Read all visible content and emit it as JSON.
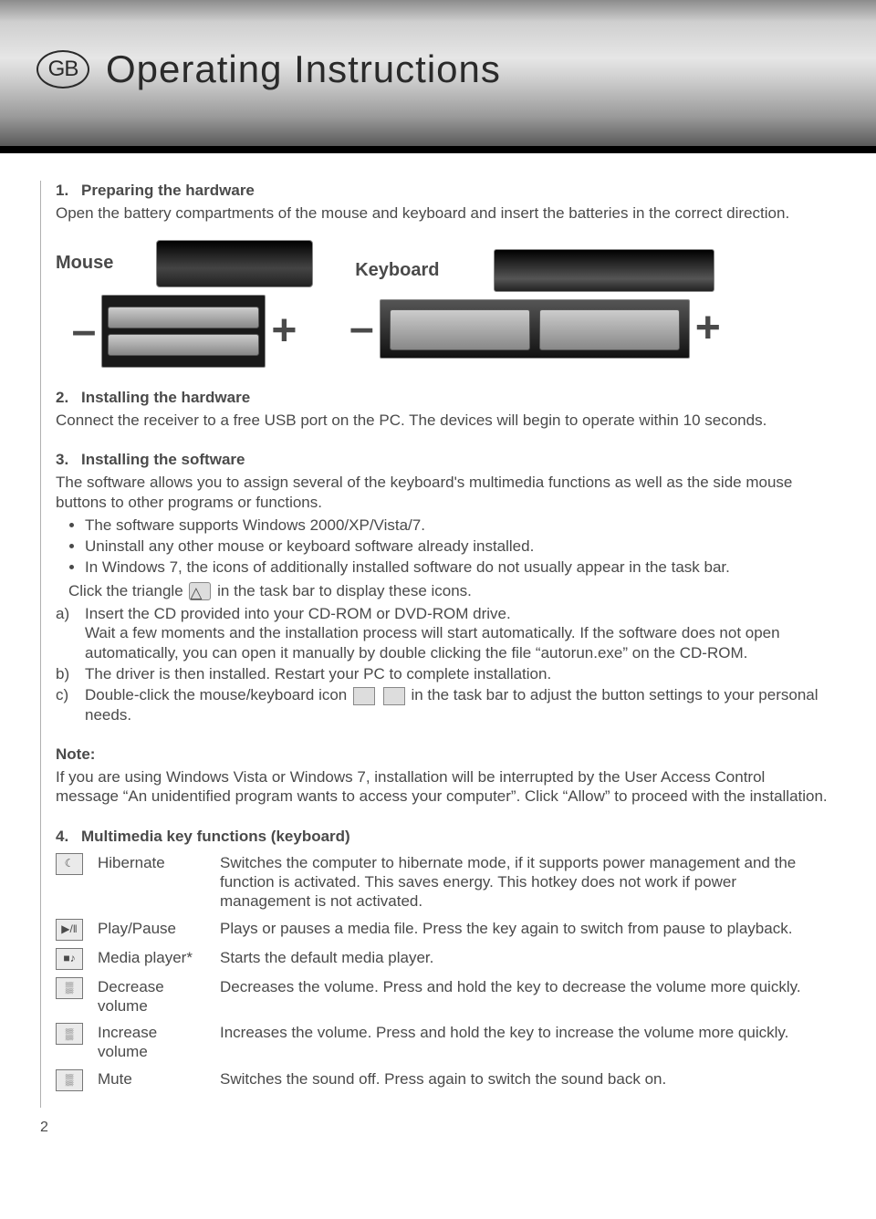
{
  "header": {
    "badge": "GB",
    "title": "Operating Instructions"
  },
  "sections": {
    "s1": {
      "num": "1.",
      "heading": "Preparing the hardware",
      "body": "Open the battery compartments of the mouse and keyboard and insert the batteries in the correct direction."
    },
    "hw": {
      "mouse_label": "Mouse",
      "keyboard_label": "Keyboard",
      "minus": "–",
      "plus": "+"
    },
    "s2": {
      "num": "2.",
      "heading": "Installing the hardware",
      "body": "Connect the receiver to a free USB port on the PC. The devices will begin to operate within 10 seconds."
    },
    "s3": {
      "num": "3.",
      "heading": "Installing the software",
      "body": "The software allows you to assign several of the keyboard's multimedia functions as well as the side mouse buttons to other programs or functions.",
      "bullets": [
        "The software supports Windows 2000/XP/Vista/7.",
        "Uninstall any other mouse or keyboard software already installed.",
        "In Windows 7, the icons of additionally installed software do not usually appear in the task bar."
      ],
      "click_line_a": "Click the triangle",
      "click_line_b": "in the task bar to display these icons.",
      "steps": {
        "a": {
          "lt": "a)",
          "text1": "Insert the CD provided into your CD-ROM or DVD-ROM drive.",
          "text2": "Wait a few moments and the installation process will start automatically. If the software does not open automatically, you can open it manually by double clicking the file “autorun.exe” on the CD-ROM."
        },
        "b": {
          "lt": "b)",
          "text": "The driver is then installed. Restart your PC to complete installation."
        },
        "c": {
          "lt": "c)",
          "text1": "Double-click the mouse/keyboard icon",
          "text2": "in the task bar to adjust the button settings to your personal needs."
        }
      }
    },
    "note": {
      "heading": "Note:",
      "body": "If you are using Windows Vista or Windows 7, installation will be interrupted by the User Access Control message “An unidentified program wants to access your computer”. Click “Allow” to proceed with the installation."
    },
    "s4": {
      "num": "4.",
      "heading": "Multimedia key functions (keyboard)",
      "rows": [
        {
          "icon": "hibernate-icon",
          "glyph": "☾",
          "name": "Hibernate",
          "desc": "Switches the computer to hibernate mode, if it supports power management and the function is activated. This saves energy. This hotkey does not work if power management is not activated."
        },
        {
          "icon": "play-pause-icon",
          "glyph": "▶/‖",
          "name": "Play/Pause",
          "desc": "Plays or pauses a media file. Press the key again to switch from pause to playback."
        },
        {
          "icon": "media-player-icon",
          "glyph": "■♪",
          "name": "Media player*",
          "desc": "Starts the default media player."
        },
        {
          "icon": "vol-down-icon",
          "glyph": "▒",
          "name": "Decrease volume",
          "desc": "Decreases the volume. Press and hold the key to decrease the volume more quickly."
        },
        {
          "icon": "vol-up-icon",
          "glyph": "▒",
          "name": "Increase volume",
          "desc": "Increases the volume. Press and hold the key to increase the volume more quickly."
        },
        {
          "icon": "mute-icon",
          "glyph": "▒",
          "name": "Mute",
          "desc": "Switches the sound off. Press again to switch the sound back on."
        }
      ]
    }
  },
  "page_number": "2"
}
